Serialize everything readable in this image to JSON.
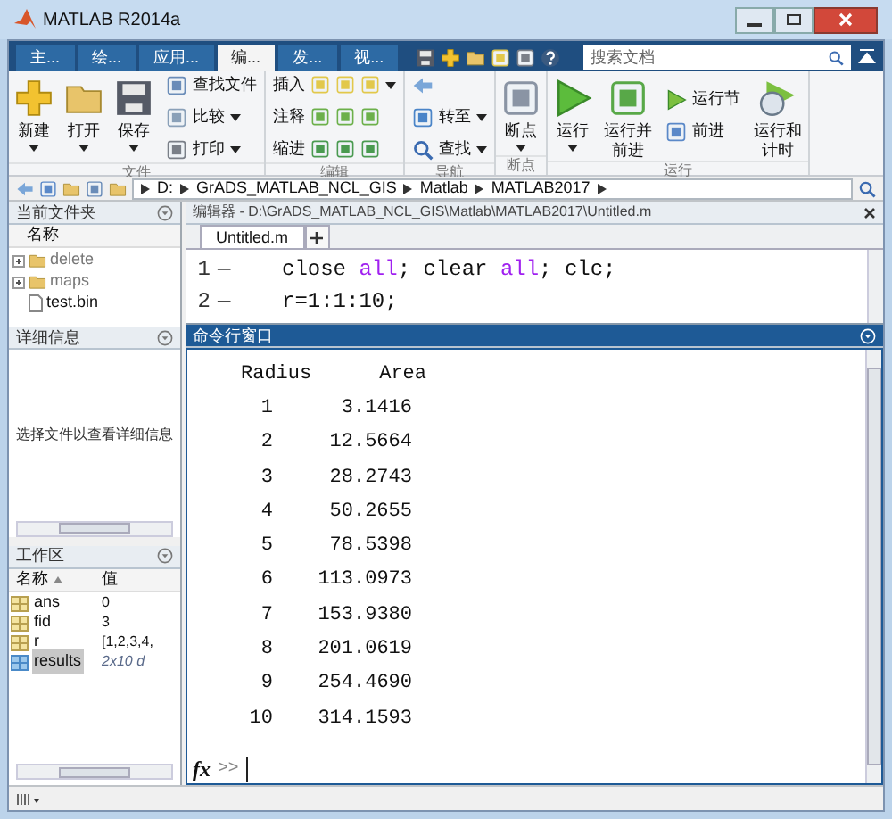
{
  "window": {
    "title": "MATLAB R2014a"
  },
  "tabs": [
    {
      "label": "主...",
      "selected": false
    },
    {
      "label": "绘...",
      "selected": false
    },
    {
      "label": "应用...",
      "selected": false
    },
    {
      "label": "编...",
      "selected": true
    },
    {
      "label": "发...",
      "selected": false
    },
    {
      "label": "视...",
      "selected": false
    }
  ],
  "search": {
    "placeholder": "搜索文档"
  },
  "ribbon": {
    "groups": [
      {
        "label": "文件",
        "items": [
          {
            "kind": "large",
            "label": "新建",
            "menu": true
          },
          {
            "kind": "large",
            "label": "打开",
            "menu": true
          },
          {
            "kind": "large",
            "label": "保存",
            "menu": true
          },
          {
            "kind": "stack",
            "rows": [
              {
                "label": "查找文件",
                "menu": false
              },
              {
                "label": "比较",
                "menu": true
              },
              {
                "label": "打印",
                "menu": true
              }
            ]
          }
        ]
      },
      {
        "label": "编辑",
        "items": [
          {
            "kind": "tools",
            "rows": [
              {
                "label": "插入",
                "menu": true
              },
              {
                "label": "注释",
                "menu": false
              },
              {
                "label": "缩进",
                "menu": false
              }
            ]
          }
        ]
      },
      {
        "label": "导航",
        "items": [
          {
            "kind": "stack",
            "rows": [
              {
                "menu": false
              },
              {
                "label": "转至",
                "menu": true
              },
              {
                "label": "查找",
                "menu": true
              }
            ]
          }
        ]
      },
      {
        "label": "断点",
        "items": [
          {
            "kind": "large",
            "label": "断点",
            "menu": true
          }
        ]
      },
      {
        "label": "运行",
        "items": [
          {
            "kind": "large",
            "label": "运行",
            "menu": true
          },
          {
            "kind": "large",
            "label": "运行并前进",
            "menu": false
          },
          {
            "kind": "stack",
            "rows": [
              {
                "label": "运行节",
                "menu": false
              },
              {
                "label": "前进",
                "menu": false
              }
            ]
          },
          {
            "kind": "large",
            "label": "运行和计时",
            "menu": false
          }
        ]
      }
    ]
  },
  "address": {
    "segments": [
      "D:",
      "GrADS_MATLAB_NCL_GIS",
      "Matlab",
      "MATLAB2017"
    ]
  },
  "current_folder": {
    "title": "当前文件夹",
    "column": "名称",
    "items": [
      {
        "name": "delete",
        "kind": "folder"
      },
      {
        "name": "maps",
        "kind": "folder"
      },
      {
        "name": "test.bin",
        "kind": "file"
      }
    ]
  },
  "details": {
    "title": "详细信息",
    "message": "选择文件以查看详细信息"
  },
  "workspace": {
    "title": "工作区",
    "columns": [
      "名称",
      "值"
    ],
    "rows": [
      {
        "name": "ans",
        "value": "0",
        "selected": false,
        "kind": "literal"
      },
      {
        "name": "fid",
        "value": "3",
        "selected": false,
        "kind": "literal"
      },
      {
        "name": "r",
        "value": "[1,2,3,4,",
        "selected": false,
        "kind": "literal"
      },
      {
        "name": "results",
        "value": "2x10 d",
        "selected": true,
        "kind": "summary"
      }
    ]
  },
  "editor": {
    "title": "编辑器 - D:\\GrADS_MATLAB_NCL_GIS\\Matlab\\MATLAB2017\\Untitled.m",
    "tabs": [
      {
        "label": "Untitled.m",
        "selected": true
      }
    ],
    "lines": [
      {
        "number": "1",
        "marker": "—",
        "tokens": [
          {
            "text": "close ",
            "kind": "plain"
          },
          {
            "text": "all",
            "kind": "string"
          },
          {
            "text": "; clear ",
            "kind": "plain"
          },
          {
            "text": "all",
            "kind": "string"
          },
          {
            "text": "; clc;",
            "kind": "plain"
          }
        ]
      },
      {
        "number": "2",
        "marker": "—",
        "tokens": [
          {
            "text": "r=1:1:10;",
            "kind": "plain"
          }
        ]
      }
    ]
  },
  "command_window": {
    "title": "命令行窗口",
    "header": [
      "Radius",
      "Area"
    ],
    "rows": [
      [
        "1",
        "3.1416"
      ],
      [
        "2",
        "12.5664"
      ],
      [
        "3",
        "28.2743"
      ],
      [
        "4",
        "50.2655"
      ],
      [
        "5",
        "78.5398"
      ],
      [
        "6",
        "113.0973"
      ],
      [
        "7",
        "153.9380"
      ],
      [
        "8",
        "201.0619"
      ],
      [
        "9",
        "254.4690"
      ],
      [
        "10",
        "314.1593"
      ]
    ],
    "fx": "fx",
    "prompt": ">>"
  }
}
